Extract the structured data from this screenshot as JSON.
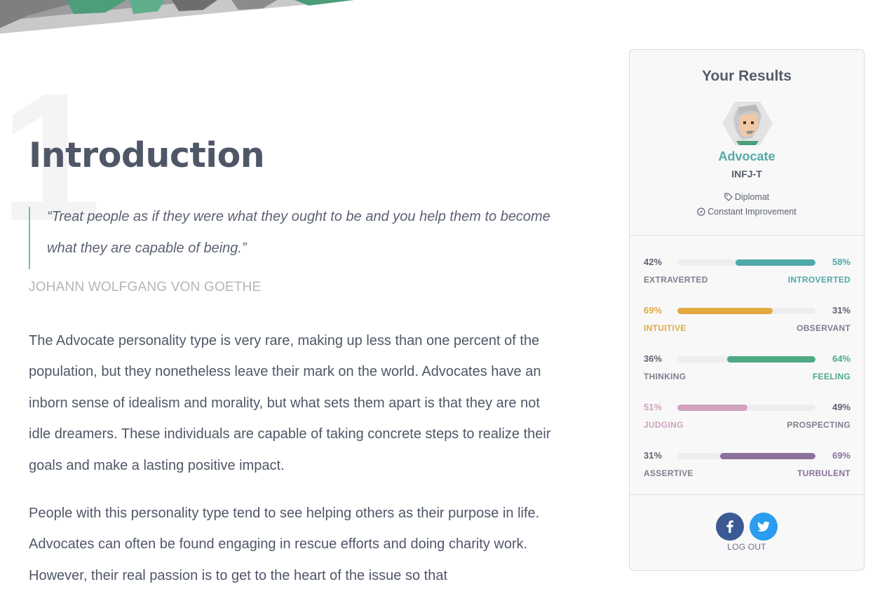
{
  "article": {
    "section_number": "1",
    "title": "Introduction",
    "quote": "“Treat people as if they were what they ought to be and you help them to become what they are capable of being.”",
    "quote_author": "JOHANN WOLFGANG VON GOETHE",
    "paragraphs": [
      "The Advocate personality type is very rare, making up less than one percent of the population, but they nonetheless leave their mark on the world. Advocates have an inborn sense of idealism and morality, but what sets them apart is that they are not idle dreamers. These individuals are capable of taking concrete steps to realize their goals and make a lasting positive impact.",
      "People with this personality type tend to see helping others as their purpose in life. Advocates can often be found engaging in rescue efforts and doing charity work. However, their real passion is to get to the heart of the issue so that"
    ]
  },
  "results": {
    "title": "Your Results",
    "type_name": "Advocate",
    "type_code": "INFJ-T",
    "role": "Diplomat",
    "strategy": "Constant Improvement",
    "avatar_icon": "advocate-avatar",
    "traits": [
      {
        "left_pct": "42%",
        "right_pct": "58%",
        "left_label": "EXTRAVERTED",
        "right_label": "INTROVERTED",
        "dominant": "right",
        "value": 58,
        "color": "#4fa8a9"
      },
      {
        "left_pct": "69%",
        "right_pct": "31%",
        "left_label": "INTUITIVE",
        "right_label": "OBSERVANT",
        "dominant": "left",
        "value": 69,
        "color": "#e2a93f"
      },
      {
        "left_pct": "36%",
        "right_pct": "64%",
        "left_label": "THINKING",
        "right_label": "FEELING",
        "dominant": "right",
        "value": 64,
        "color": "#4eaa84"
      },
      {
        "left_pct": "51%",
        "right_pct": "49%",
        "left_label": "JUDGING",
        "right_label": "PROSPECTING",
        "dominant": "left",
        "value": 51,
        "color": "#d1a1bd"
      },
      {
        "left_pct": "31%",
        "right_pct": "69%",
        "left_label": "ASSERTIVE",
        "right_label": "TURBULENT",
        "dominant": "right",
        "value": 69,
        "color": "#8a729b"
      }
    ],
    "neutral_color": "#5d6371",
    "logout_label": "LOG OUT",
    "social": {
      "facebook_icon": "facebook-icon",
      "twitter_icon": "twitter-icon"
    }
  }
}
